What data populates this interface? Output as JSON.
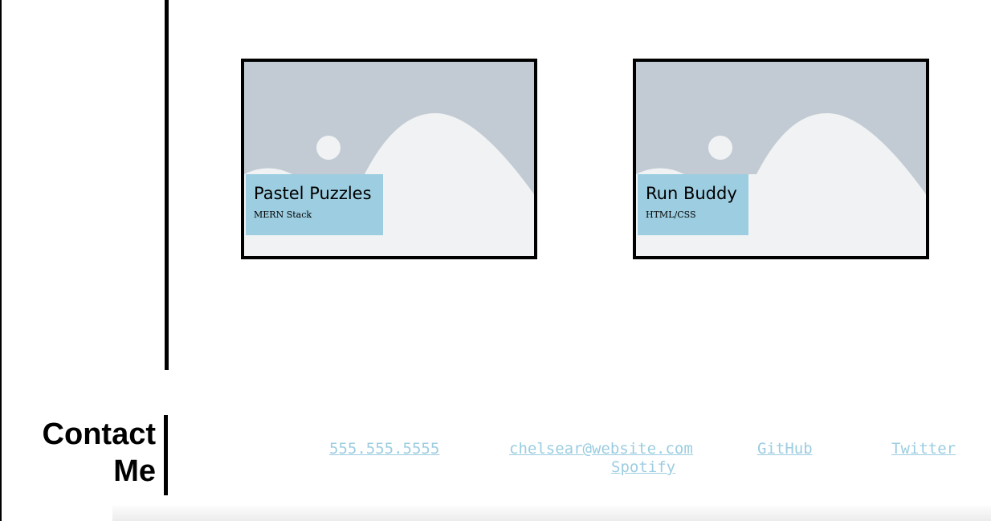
{
  "projects": [
    {
      "title": "Pastel Puzzles",
      "stack": "MERN Stack"
    },
    {
      "title": "Run Buddy",
      "stack": "HTML/CSS"
    }
  ],
  "contact": {
    "heading_line1": "Contact",
    "heading_line2": "Me",
    "phone": "555.555.5555",
    "email": "chelsear@website.com",
    "github": "GitHub",
    "twitter": "Twitter",
    "spotify": "Spotify"
  },
  "colors": {
    "accent": "#9ccde0",
    "placeholder_sky": "#c2cbd3",
    "placeholder_ground": "#f0f2f4"
  },
  "icons": {
    "project_thumbnail": "image-placeholder-icon"
  }
}
